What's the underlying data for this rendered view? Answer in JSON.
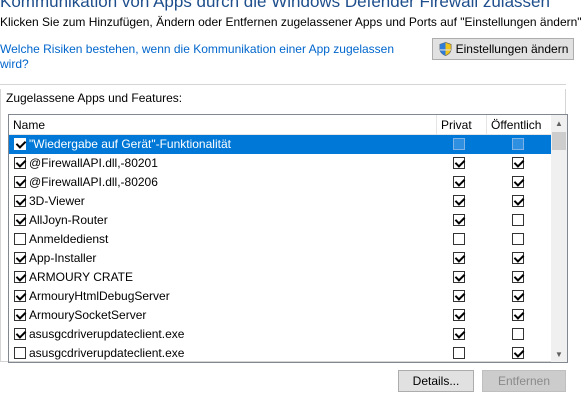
{
  "header": {
    "title": "Kommunikation von Apps durch die Windows Defender Firewall zulassen",
    "subtitle": "Klicken Sie zum Hinzufügen, Ändern oder Entfernen zugelassener Apps und Ports auf \"Einstellungen ändern\".",
    "risk_link": "Welche Risiken bestehen, wenn die Kommunikation einer App zugelassen wird?",
    "settings_button": "Einstellungen ändern"
  },
  "group": {
    "label": "Zugelassene Apps und Features:"
  },
  "table": {
    "columns": {
      "name": "Name",
      "private": "Privat",
      "public": "Öffentlich"
    },
    "rows": [
      {
        "name": "\"Wiedergabe auf Gerät\"-Funktionalität",
        "enabled": true,
        "private": false,
        "public": false,
        "selected": true
      },
      {
        "name": "@FirewallAPI.dll,-80201",
        "enabled": true,
        "private": true,
        "public": true
      },
      {
        "name": "@FirewallAPI.dll,-80206",
        "enabled": true,
        "private": true,
        "public": true
      },
      {
        "name": "3D-Viewer",
        "enabled": true,
        "private": true,
        "public": true
      },
      {
        "name": "AllJoyn-Router",
        "enabled": true,
        "private": true,
        "public": false
      },
      {
        "name": "Anmeldedienst",
        "enabled": false,
        "private": false,
        "public": false
      },
      {
        "name": "App-Installer",
        "enabled": true,
        "private": true,
        "public": true
      },
      {
        "name": "ARMOURY CRATE",
        "enabled": true,
        "private": true,
        "public": true
      },
      {
        "name": "ArmouryHtmlDebugServer",
        "enabled": true,
        "private": true,
        "public": true
      },
      {
        "name": "ArmourySocketServer",
        "enabled": true,
        "private": true,
        "public": true
      },
      {
        "name": "asusgcdriverupdateclient.exe",
        "enabled": true,
        "private": true,
        "public": false
      },
      {
        "name": "asusgcdriverupdateclient.exe",
        "enabled": false,
        "private": false,
        "public": true
      }
    ]
  },
  "buttons": {
    "details": "Details...",
    "remove": "Entfernen"
  },
  "icons": {
    "settings_icon": "shield-icon",
    "scroll_up": "chevron-up-icon",
    "scroll_down": "chevron-down-icon"
  },
  "colors": {
    "title": "#1e4e8c",
    "link": "#0066cc",
    "selection": "#0078d7"
  }
}
